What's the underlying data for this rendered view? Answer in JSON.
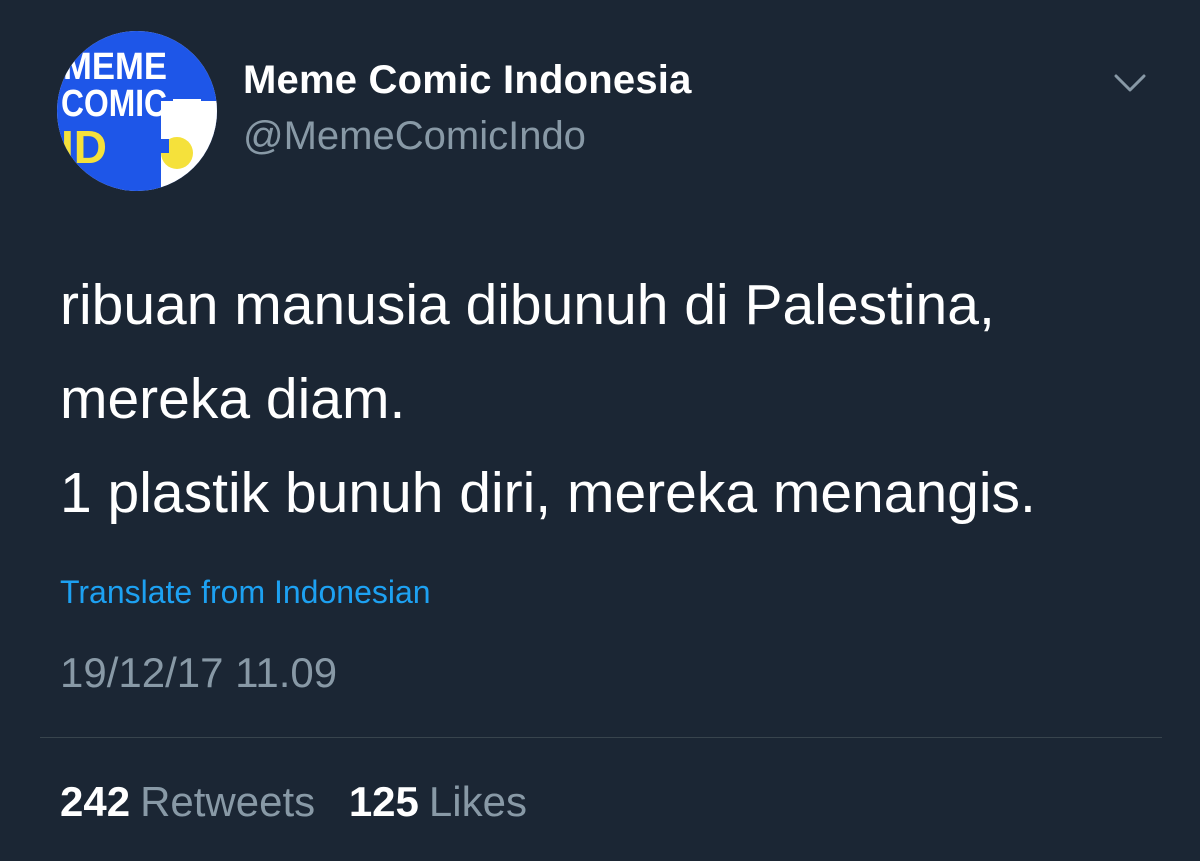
{
  "user": {
    "display_name": "Meme Comic Indonesia",
    "handle": "@MemeComicIndo",
    "avatar_text": [
      "MEME",
      "COMIC",
      "ID"
    ]
  },
  "tweet": {
    "lines": [
      "ribuan manusia dibunuh di Palestina,",
      "mereka diam.",
      "1 plastik bunuh diri, mereka menangis."
    ],
    "translate_label": "Translate from Indonesian",
    "timestamp": "19/12/17 11.09"
  },
  "stats": {
    "retweets_count": "242",
    "retweets_label": "Retweets",
    "likes_count": "125",
    "likes_label": "Likes"
  },
  "icons": {
    "menu": "chevron-down-icon"
  },
  "colors": {
    "background": "#1b2634",
    "link": "#1da1f2",
    "muted": "#8899a6",
    "avatar_blue": "#1e56e8",
    "avatar_yellow": "#f5e13b"
  }
}
